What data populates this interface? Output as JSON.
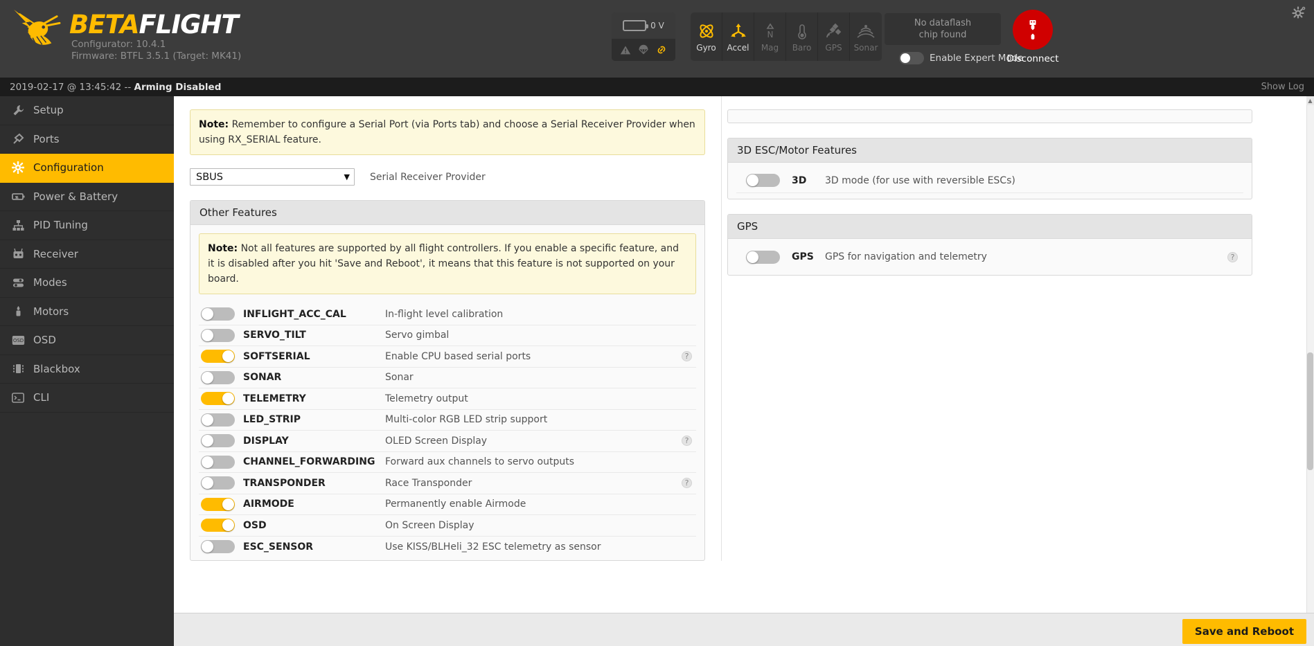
{
  "header": {
    "brand_beta": "BETA",
    "brand_flight": "FLIGHT",
    "configurator": "Configurator: 10.4.1",
    "firmware": "Firmware: BTFL 3.5.1 (Target: MK41)",
    "battery_voltage": "0 V",
    "battery_icons": [
      "warning-icon",
      "parachute-icon",
      "link-icon"
    ],
    "sensors": [
      {
        "label": "Gyro",
        "active": true,
        "icon": "gyro-icon"
      },
      {
        "label": "Accel",
        "active": true,
        "icon": "accel-icon"
      },
      {
        "label": "Mag",
        "active": false,
        "icon": "compass-icon"
      },
      {
        "label": "Baro",
        "active": false,
        "icon": "thermometer-icon"
      },
      {
        "label": "GPS",
        "active": false,
        "icon": "satellite-icon"
      },
      {
        "label": "Sonar",
        "active": false,
        "icon": "sonar-icon"
      }
    ],
    "dataflash_line1": "No dataflash",
    "dataflash_line2": "chip found",
    "expert_mode_label": "Enable Expert Mode",
    "expert_mode_enabled": false,
    "disconnect_label": "Disconnect",
    "accent_color": "#ffbb00",
    "disconnect_color": "#d00000"
  },
  "statusbar": {
    "timestamp": "2019-02-17 @ 13:45:42 -- ",
    "state": "Arming Disabled",
    "show_log": "Show Log"
  },
  "sidebar": {
    "items": [
      {
        "label": "Setup",
        "icon": "wrench-icon",
        "active": false
      },
      {
        "label": "Ports",
        "icon": "plug-icon",
        "active": false
      },
      {
        "label": "Configuration",
        "icon": "gear-icon",
        "active": true
      },
      {
        "label": "Power & Battery",
        "icon": "battery-icon",
        "active": false
      },
      {
        "label": "PID Tuning",
        "icon": "sitemap-icon",
        "active": false
      },
      {
        "label": "Receiver",
        "icon": "remote-icon",
        "active": false
      },
      {
        "label": "Modes",
        "icon": "sliders-icon",
        "active": false
      },
      {
        "label": "Motors",
        "icon": "motor-icon",
        "active": false
      },
      {
        "label": "OSD",
        "icon": "osd-icon",
        "active": false
      },
      {
        "label": "Blackbox",
        "icon": "blackbox-icon",
        "active": false
      },
      {
        "label": "CLI",
        "icon": "terminal-icon",
        "active": false
      }
    ]
  },
  "main": {
    "serial_note_bold": "Note:",
    "serial_note_text": " Remember to configure a Serial Port (via Ports tab) and choose a Serial Receiver Provider when using RX_SERIAL feature.",
    "serial_provider_value": "SBUS",
    "serial_provider_label": "Serial Receiver Provider",
    "other_features_title": "Other Features",
    "features_note_bold": "Note:",
    "features_note_text": " Not all features are supported by all flight controllers. If you enable a specific feature, and it is disabled after you hit 'Save and Reboot', it means that this feature is not supported on your board.",
    "features": [
      {
        "name": "INFLIGHT_ACC_CAL",
        "desc": "In-flight level calibration",
        "on": false,
        "help": false
      },
      {
        "name": "SERVO_TILT",
        "desc": "Servo gimbal",
        "on": false,
        "help": false
      },
      {
        "name": "SOFTSERIAL",
        "desc": "Enable CPU based serial ports",
        "on": true,
        "help": true
      },
      {
        "name": "SONAR",
        "desc": "Sonar",
        "on": false,
        "help": false
      },
      {
        "name": "TELEMETRY",
        "desc": "Telemetry output",
        "on": true,
        "help": false
      },
      {
        "name": "LED_STRIP",
        "desc": "Multi-color RGB LED strip support",
        "on": false,
        "help": false
      },
      {
        "name": "DISPLAY",
        "desc": "OLED Screen Display",
        "on": false,
        "help": true
      },
      {
        "name": "CHANNEL_FORWARDING",
        "desc": "Forward aux channels to servo outputs",
        "on": false,
        "help": false
      },
      {
        "name": "TRANSPONDER",
        "desc": "Race Transponder",
        "on": false,
        "help": true
      },
      {
        "name": "AIRMODE",
        "desc": "Permanently enable Airmode",
        "on": true,
        "help": false
      },
      {
        "name": "OSD",
        "desc": "On Screen Display",
        "on": true,
        "help": false
      },
      {
        "name": "ESC_SENSOR",
        "desc": "Use KISS/BLHeli_32 ESC telemetry as sensor",
        "on": false,
        "help": false
      }
    ],
    "esc_panel_title": "3D ESC/Motor Features",
    "esc_feature": {
      "name": "3D",
      "desc": "3D mode (for use with reversible ESCs)",
      "on": false
    },
    "gps_panel_title": "GPS",
    "gps_feature": {
      "name": "GPS",
      "desc": "GPS for navigation and telemetry",
      "on": false,
      "help": true
    },
    "help_glyph": "?"
  },
  "footer": {
    "save_label": "Save and Reboot"
  }
}
